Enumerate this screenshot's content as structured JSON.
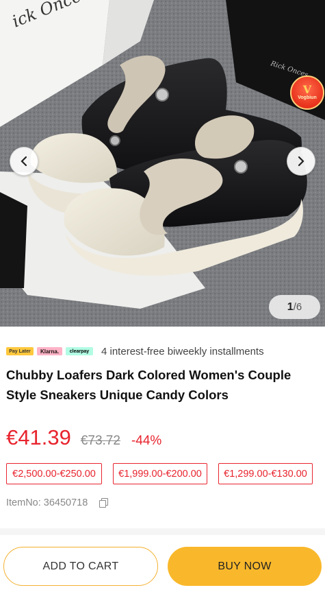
{
  "gallery": {
    "current": "1",
    "total": "/6",
    "badge_letter": "V",
    "badge_text": "Vogbiun",
    "box_text": "ick Onces"
  },
  "payment": {
    "logos": [
      "Pay Later",
      "Klarna.",
      "clearpay"
    ],
    "installment_text": "4 interest-free biweekly installments"
  },
  "product": {
    "title": "Chubby Loafers Dark Colored Women's Couple Style Sneakers Unique Candy Colors",
    "price": "€41.39",
    "original_price": "€73.72",
    "discount": "-44%",
    "coupons": [
      "€2,500.00-€250.00",
      "€1,999.00-€200.00",
      "€1,299.00-€130.00"
    ],
    "item_no": "ItemNo: 36450718"
  },
  "actions": {
    "add_to_cart": "ADD TO CART",
    "buy_now": "BUY NOW"
  },
  "colors": {
    "accent_red": "#e8242e",
    "button_yellow": "#f9b82b"
  }
}
